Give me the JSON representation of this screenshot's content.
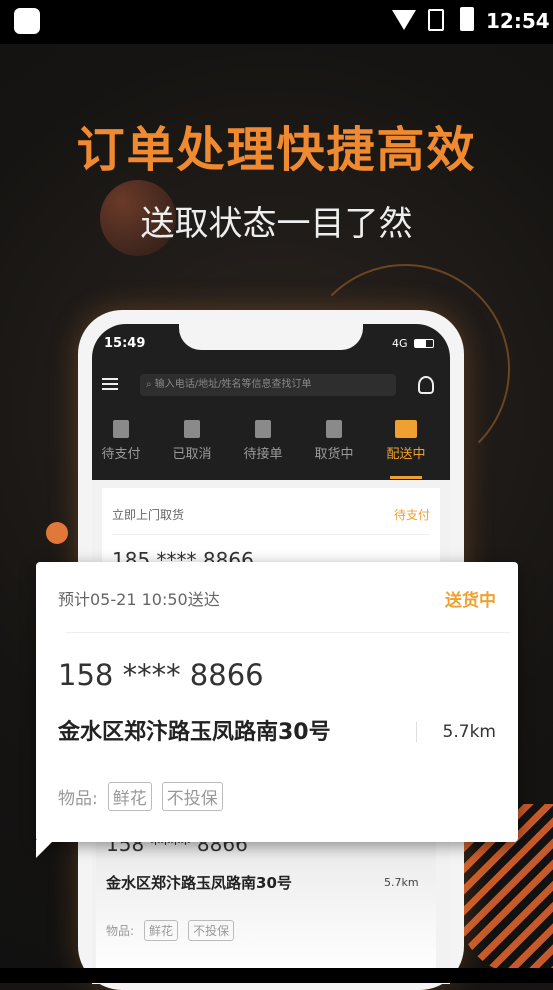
{
  "status_bar": {
    "time": "12:54",
    "icons": [
      "app-icon",
      "wifi-icon",
      "no-sim-icon",
      "battery-charging-icon"
    ]
  },
  "headline": "订单处理快捷高效",
  "subheadline": "送取状态一目了然",
  "colors": {
    "accent": "#f0a030",
    "headline_orange": "#f08a30"
  },
  "phone": {
    "status": {
      "time": "15:49",
      "network": "4G"
    },
    "search_placeholder": "输入电话/地址/姓名等信息查找订单",
    "tabs": [
      {
        "label": "待支付"
      },
      {
        "label": "已取消"
      },
      {
        "label": "待接单"
      },
      {
        "label": "取货中"
      },
      {
        "label": "配送中",
        "active": true
      }
    ],
    "card1": {
      "type": "立即上门取货",
      "status": "待支付",
      "phone": "185 **** 8866"
    },
    "card2": {
      "phone": "158 **** 8866",
      "address": "金水区郑汴路玉凤路南30号",
      "distance": "5.7km",
      "items_label": "物品:",
      "tags": [
        "鲜花",
        "不投保"
      ]
    }
  },
  "popup": {
    "eta": "预计05-21 10:50送达",
    "status": "送货中",
    "phone": "158 **** 8866",
    "address": "金水区郑汴路玉凤路南30号",
    "distance": "5.7km",
    "items_label": "物品:",
    "tags": [
      "鲜花",
      "不投保"
    ]
  }
}
